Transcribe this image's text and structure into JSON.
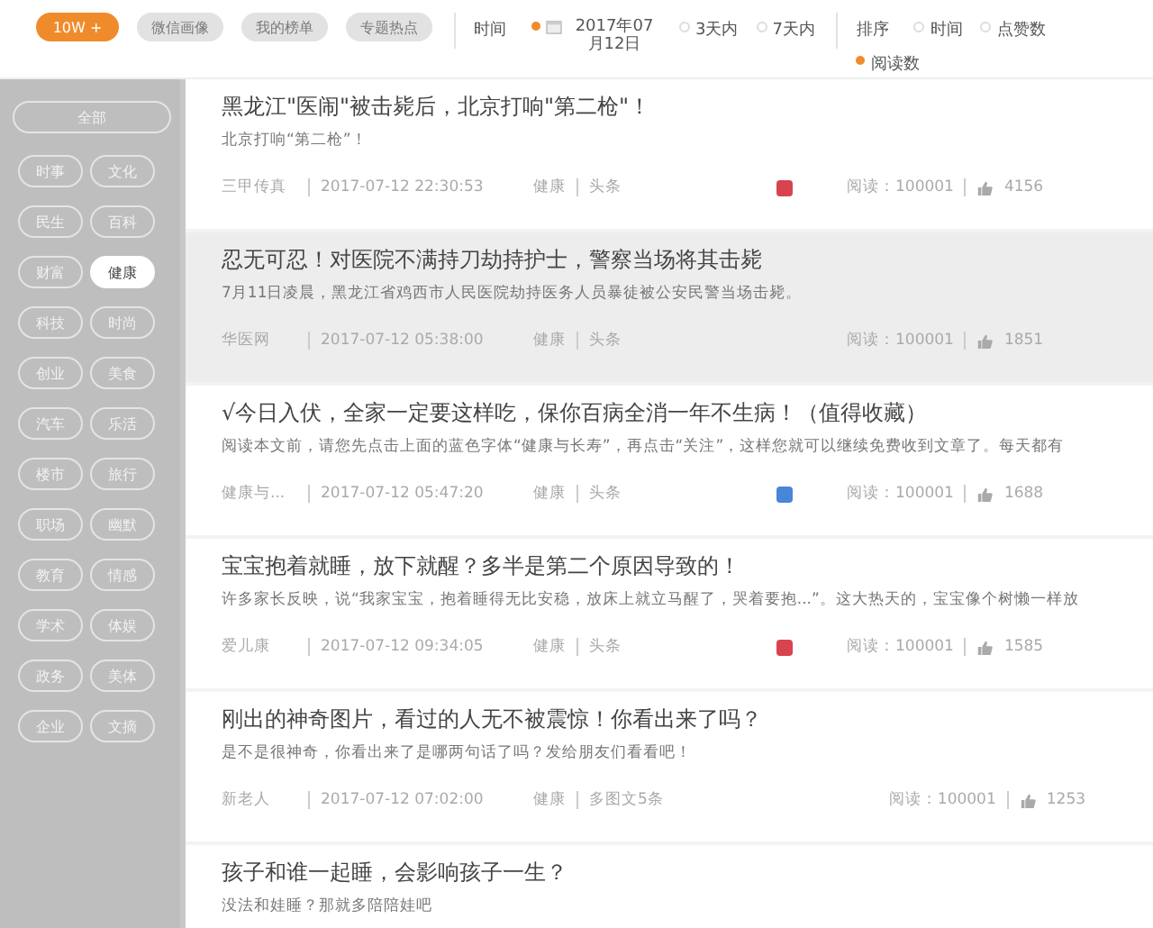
{
  "top_tabs": [
    {
      "label": "10W +",
      "selected": true
    },
    {
      "label": "微信画像",
      "selected": false
    },
    {
      "label": "我的榜单",
      "selected": false
    },
    {
      "label": "专题热点",
      "selected": false
    }
  ],
  "time_filter": {
    "label": "时间",
    "options": [
      {
        "label": "2017年07月12日",
        "kind": "date",
        "selected": true
      },
      {
        "label": "3天内",
        "kind": "plain",
        "selected": false
      },
      {
        "label": "7天内",
        "kind": "plain",
        "selected": false
      }
    ]
  },
  "sort_filter": {
    "label": "排序",
    "options": [
      {
        "label": "时间",
        "selected": false
      },
      {
        "label": "点赞数",
        "selected": false
      },
      {
        "label": "阅读数",
        "selected": true
      }
    ]
  },
  "sidebar": {
    "all": {
      "label": "全部",
      "selected": false
    },
    "items": [
      {
        "label": "时事",
        "selected": false
      },
      {
        "label": "文化",
        "selected": false
      },
      {
        "label": "民生",
        "selected": false
      },
      {
        "label": "百科",
        "selected": false
      },
      {
        "label": "财富",
        "selected": false
      },
      {
        "label": "健康",
        "selected": true
      },
      {
        "label": "科技",
        "selected": false
      },
      {
        "label": "时尚",
        "selected": false
      },
      {
        "label": "创业",
        "selected": false
      },
      {
        "label": "美食",
        "selected": false
      },
      {
        "label": "汽车",
        "selected": false
      },
      {
        "label": "乐活",
        "selected": false
      },
      {
        "label": "楼市",
        "selected": false
      },
      {
        "label": "旅行",
        "selected": false
      },
      {
        "label": "职场",
        "selected": false
      },
      {
        "label": "幽默",
        "selected": false
      },
      {
        "label": "教育",
        "selected": false
      },
      {
        "label": "情感",
        "selected": false
      },
      {
        "label": "学术",
        "selected": false
      },
      {
        "label": "体娱",
        "selected": false
      },
      {
        "label": "政务",
        "selected": false
      },
      {
        "label": "美体",
        "selected": false
      },
      {
        "label": "企业",
        "selected": false
      },
      {
        "label": "文摘",
        "selected": false
      }
    ]
  },
  "articles": [
    {
      "title": "黑龙江\"医闹\"被击毙后，北京打响\"第二枪\"！",
      "summary": "北京打响“第二枪”！",
      "source": "三甲传真",
      "time": "2017-07-12 22:30:53",
      "category": "健康",
      "position": "头条",
      "color": "#d9434e",
      "reads": "阅读：100001",
      "likes": "4156",
      "selected": false
    },
    {
      "title": "忍无可忍！对医院不满持刀劫持护士，警察当场将其击毙",
      "summary": "7月11日凌晨，黑龙江省鸡西市人民医院劫持医务人员暴徒被公安民警当场击毙。",
      "source": "华医网",
      "time": "2017-07-12 05:38:00",
      "category": "健康",
      "position": "头条",
      "reads": "阅读：100001",
      "likes": "1851",
      "selected": true
    },
    {
      "title": "√今日入伏，全家一定要这样吃，保你百病全消一年不生病！（值得收藏）",
      "summary": "阅读本文前，请您先点击上面的蓝色字体“健康与长寿”，再点击“关注”，这样您就可以继续免费收到文章了。每天都有",
      "source": "健康与...",
      "time": "2017-07-12 05:47:20",
      "category": "健康",
      "position": "头条",
      "color": "#4a86d8",
      "reads": "阅读：100001",
      "likes": "1688",
      "selected": false
    },
    {
      "title": "宝宝抱着就睡，放下就醒？多半是第二个原因导致的！",
      "summary": "许多家长反映，说“我家宝宝，抱着睡得无比安稳，放床上就立马醒了，哭着要抱...”。这大热天的，宝宝像个树懒一样放",
      "source": "爱儿康",
      "time": "2017-07-12 09:34:05",
      "category": "健康",
      "position": "头条",
      "color": "#d9434e",
      "reads": "阅读：100001",
      "likes": "1585",
      "selected": false
    },
    {
      "title": "刚出的神奇图片，看过的人无不被震惊！你看出来了吗？",
      "summary": "是不是很神奇，你看出来了是哪两句话了吗？发给朋友们看看吧！",
      "source": "新老人",
      "time": "2017-07-12 07:02:00",
      "category": "健康",
      "position": "多图文5条",
      "reads": "阅读：100001",
      "likes": "1253",
      "selected": false
    },
    {
      "title": "孩子和谁一起睡，会影响孩子一生？",
      "summary": "没法和娃睡？那就多陪陪娃吧",
      "selected": false
    }
  ]
}
